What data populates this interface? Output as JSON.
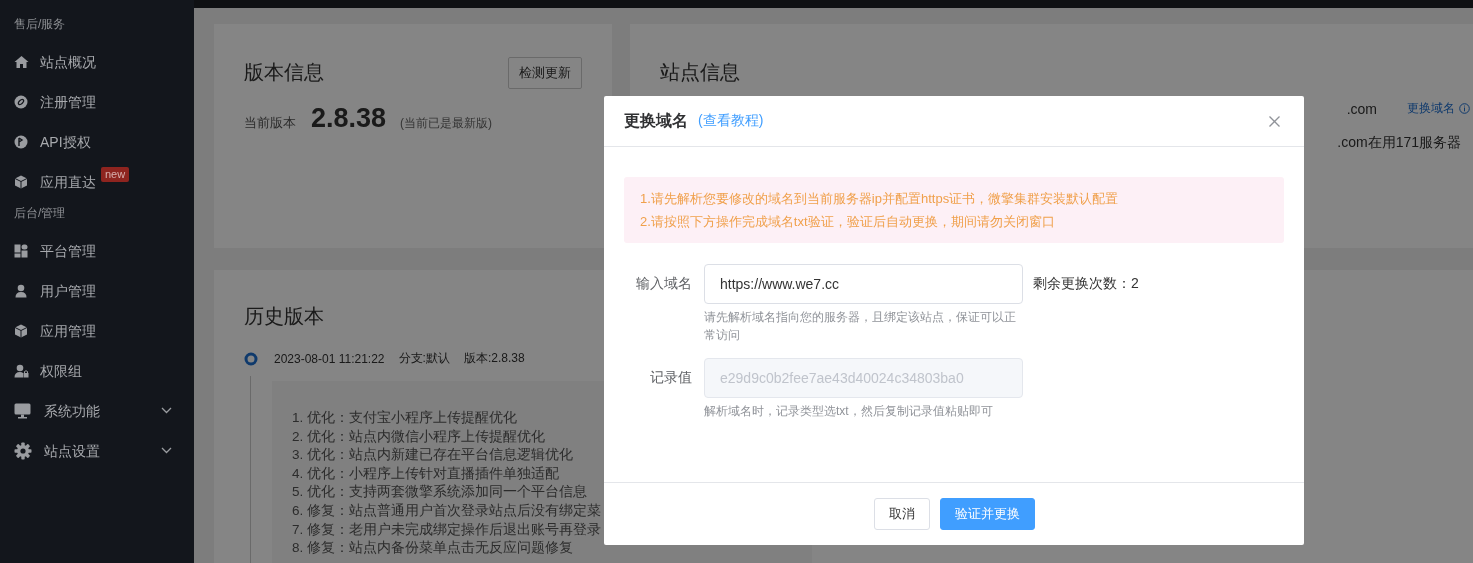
{
  "sidebar": {
    "sections": [
      {
        "title": "售后/服务",
        "items": [
          {
            "label": "站点概况",
            "kind": "link"
          },
          {
            "label": "注册管理",
            "kind": "link"
          },
          {
            "label": "API授权",
            "kind": "link"
          },
          {
            "label": "应用直达",
            "kind": "link",
            "badge": "new"
          }
        ]
      },
      {
        "title": "后台/管理",
        "items": [
          {
            "label": "平台管理",
            "kind": "link"
          },
          {
            "label": "用户管理",
            "kind": "link"
          },
          {
            "label": "应用管理",
            "kind": "link"
          },
          {
            "label": "权限组",
            "kind": "link"
          },
          {
            "label": "系统功能",
            "kind": "submenu",
            "expanded": false
          },
          {
            "label": "站点设置",
            "kind": "submenu",
            "expanded": false
          }
        ]
      }
    ]
  },
  "version_card": {
    "title": "版本信息",
    "check_button": "检测更新",
    "current_label": "当前版本",
    "version": "2.8.38",
    "note": "(当前已是最新版)"
  },
  "site_card": {
    "title": "站点信息",
    "domain": ".com",
    "change_domain_link": "更换域名",
    "server_note": ".com在用171服务器"
  },
  "history_card": {
    "title": "历史版本",
    "entries": [
      {
        "date": "2023-08-01 11:21:22",
        "branch": "分支:默认",
        "version": "版本:2.8.38",
        "changes": [
          "1. 优化：支付宝小程序上传提醒优化",
          "2. 优化：站点内微信小程序上传提醒优化",
          "3. 优化：站点内新建已存在平台信息逻辑优化",
          "4. 优化：小程序上传针对直播插件单独适配",
          "5. 优化：支持两套微擎系统添加同一个平台信息",
          "6. 修复：站点普通用户首次登录站点后没有绑定菜",
          "7. 修复：老用户未完成绑定操作后退出账号再登录",
          "8. 修复：站点内备份菜单点击无反应问题修复"
        ]
      }
    ]
  },
  "dialog": {
    "title": "更换域名",
    "tutorial_link": "(查看教程)",
    "notices": [
      "1.请先解析您要修改的域名到当前服务器ip并配置https证书，微擎集群安装默认配置",
      "2.请按照下方操作完成域名txt验证，验证后自动更换，期间请勿关闭窗口"
    ],
    "fields": [
      {
        "label": "输入域名",
        "value": "https://www.we7.cc",
        "disabled": false,
        "help": "请先解析域名指向您的服务器，且绑定该站点，保证可以正常访问",
        "aside": "剩余更换次数：2"
      },
      {
        "label": "记录值",
        "value": "e29d9c0b2fee7ae43d40024c34803ba0",
        "disabled": true,
        "help": "解析域名时，记录类型选txt，然后复制记录值粘贴即可"
      }
    ],
    "buttons": [
      {
        "label": "取消",
        "kind": "default"
      },
      {
        "label": "验证并更换",
        "kind": "primary"
      }
    ]
  }
}
